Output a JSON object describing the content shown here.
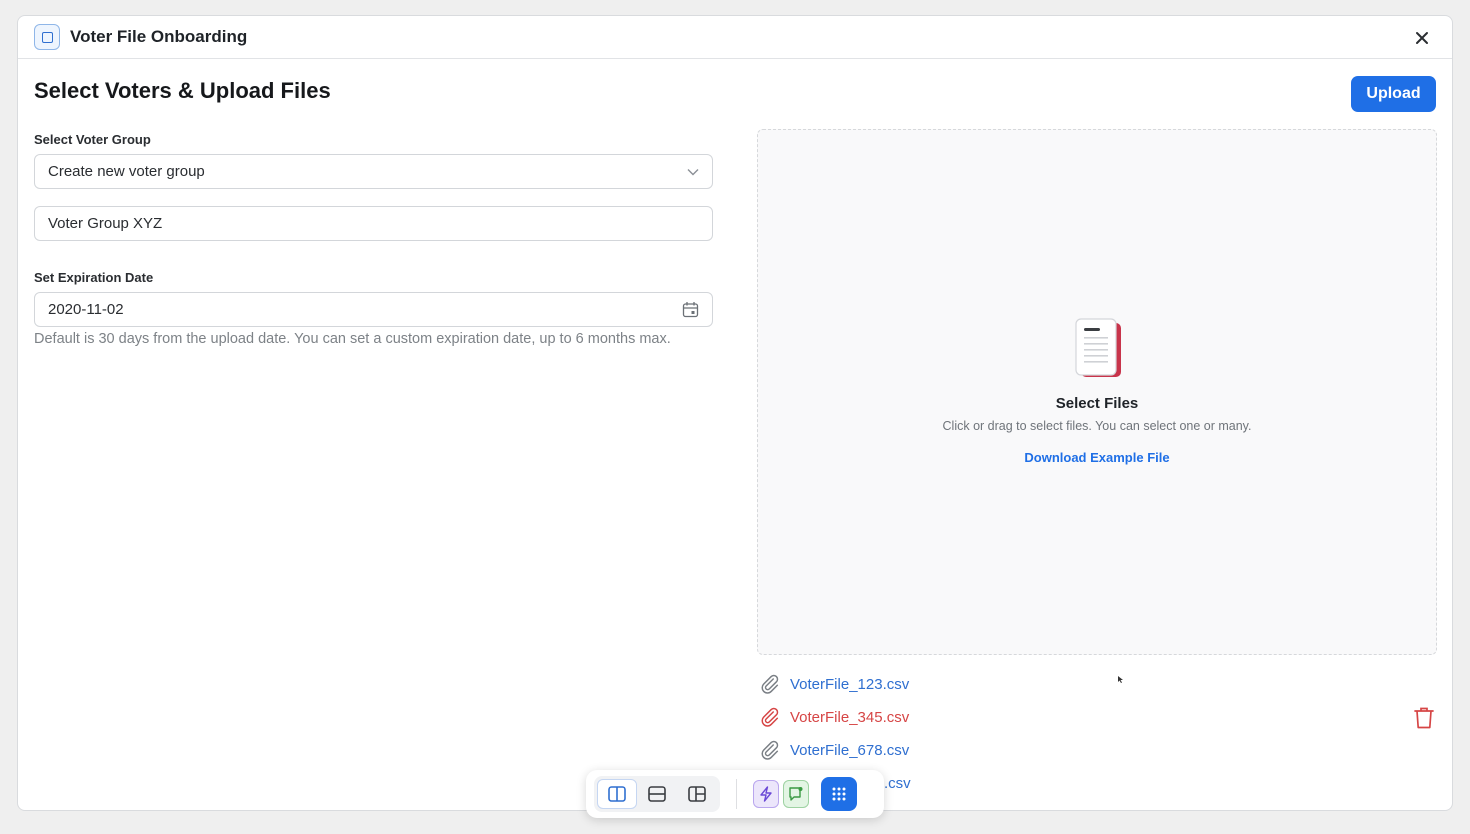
{
  "window": {
    "title": "Voter File Onboarding"
  },
  "page": {
    "heading": "Select Voters & Upload Files",
    "upload_label": "Upload"
  },
  "form": {
    "group_label": "Select Voter Group",
    "group_selected": "Create new voter group",
    "group_name_value": "Voter Group XYZ",
    "expiration_label": "Set Expiration Date",
    "expiration_value": "2020-11-02",
    "expiration_hint": "Default is 30 days from the upload date. You can set a custom expiration date, up to 6 months max."
  },
  "dropzone": {
    "title": "Select Files",
    "subtitle": "Click or drag to select files. You can select one or many.",
    "example_link": "Download Example File"
  },
  "files": [
    {
      "name": "VoterFile_123.csv",
      "status": "ok"
    },
    {
      "name": "VoterFile_345.csv",
      "status": "error"
    },
    {
      "name": "VoterFile_678.csv",
      "status": "ok"
    },
    {
      "name": ".csv",
      "status": "ok"
    }
  ],
  "colors": {
    "accent": "#1f6fe6",
    "link": "#2f6fd0",
    "error": "#d64545"
  },
  "toolbar": {
    "buttons": [
      "split-vertical-icon",
      "split-horizontal-icon",
      "grid-layout-icon",
      "lightning-icon",
      "chat-flag-icon",
      "apps-grid-icon"
    ]
  }
}
